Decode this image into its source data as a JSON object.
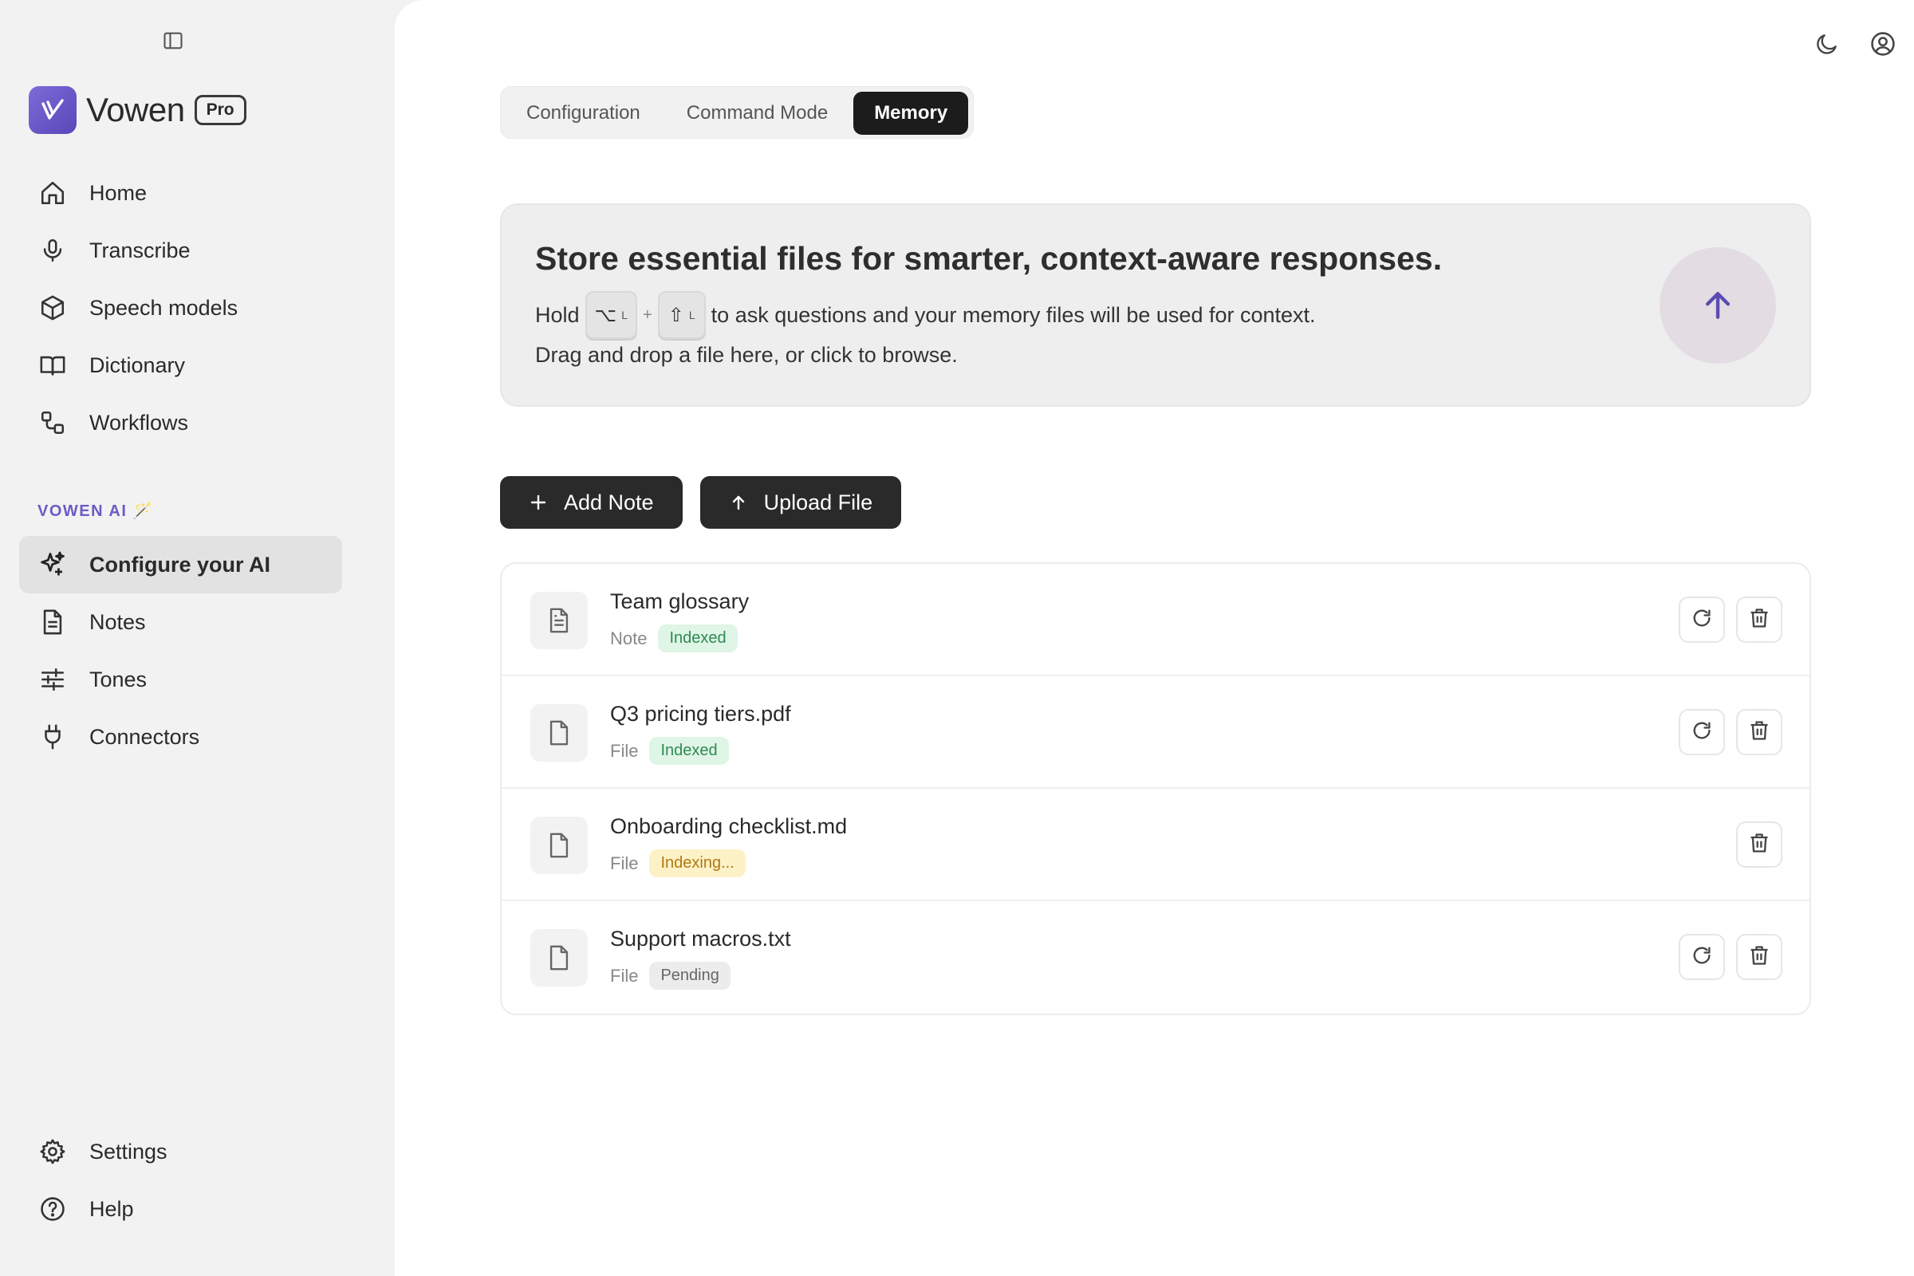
{
  "brand": {
    "name": "Vowen",
    "badge": "Pro"
  },
  "nav_primary": [
    {
      "label": "Home",
      "icon": "home-icon"
    },
    {
      "label": "Transcribe",
      "icon": "microphone-icon"
    },
    {
      "label": "Speech models",
      "icon": "cube-icon"
    },
    {
      "label": "Dictionary",
      "icon": "book-icon"
    },
    {
      "label": "Workflows",
      "icon": "workflow-icon"
    }
  ],
  "section_label": "VOWEN AI 🪄",
  "nav_ai": [
    {
      "label": "Configure your AI",
      "icon": "sparkles-icon",
      "active": true
    },
    {
      "label": "Notes",
      "icon": "note-icon"
    },
    {
      "label": "Tones",
      "icon": "sliders-icon"
    },
    {
      "label": "Connectors",
      "icon": "plug-icon"
    }
  ],
  "nav_bottom": [
    {
      "label": "Settings",
      "icon": "gear-icon"
    },
    {
      "label": "Help",
      "icon": "help-icon"
    }
  ],
  "tabs": [
    {
      "label": "Configuration",
      "active": false
    },
    {
      "label": "Command Mode",
      "active": false
    },
    {
      "label": "Memory",
      "active": true
    }
  ],
  "dropzone": {
    "title": "Store essential files for smarter, context-aware responses.",
    "hold_prefix": "Hold",
    "key1": "⌥",
    "key1_side": "L",
    "key_plus": "+",
    "key2": "⇧",
    "key2_side": "L",
    "hold_suffix": "to ask questions and your memory files will be used for context.",
    "subtitle": "Drag and drop a file here, or click to browse."
  },
  "actions": {
    "add_note": "Add Note",
    "upload_file": "Upload File"
  },
  "files": [
    {
      "name": "Team glossary",
      "type": "Note",
      "status": "Indexed",
      "status_kind": "indexed",
      "icon": "note-file-icon",
      "refresh": true
    },
    {
      "name": "Q3 pricing tiers.pdf",
      "type": "File",
      "status": "Indexed",
      "status_kind": "indexed",
      "icon": "file-icon",
      "refresh": true
    },
    {
      "name": "Onboarding checklist.md",
      "type": "File",
      "status": "Indexing...",
      "status_kind": "indexing",
      "icon": "file-icon",
      "refresh": false
    },
    {
      "name": "Support macros.txt",
      "type": "File",
      "status": "Pending",
      "status_kind": "pending",
      "icon": "file-icon",
      "refresh": true
    }
  ],
  "colors": {
    "accent": "#6b5bc4",
    "dark_button": "#2a2a2a",
    "indexed": "#2f8a52",
    "indexing": "#b07a10"
  }
}
